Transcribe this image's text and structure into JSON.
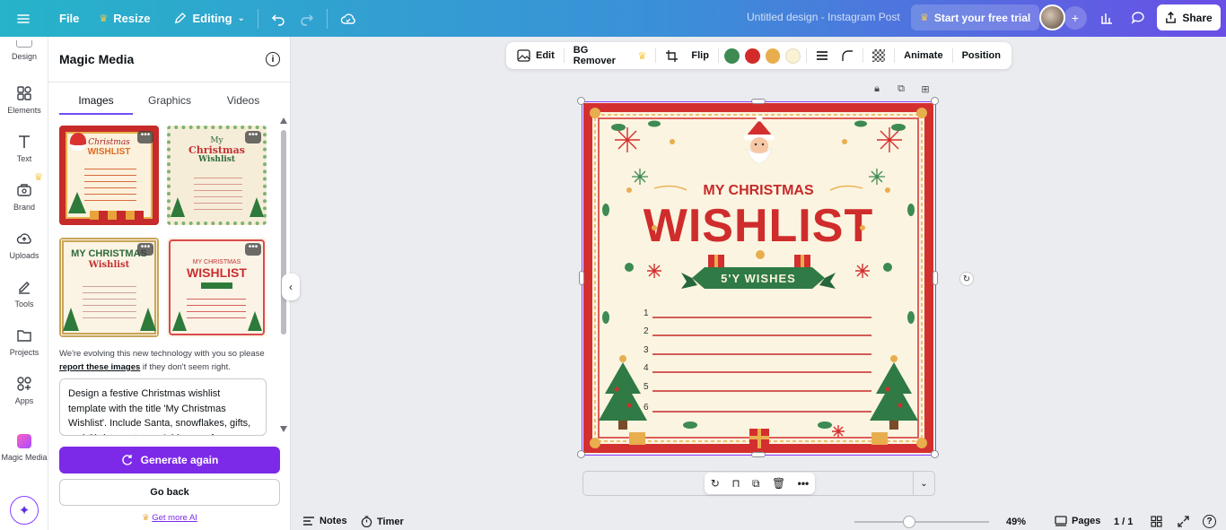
{
  "topbar": {
    "file": "File",
    "resize": "Resize",
    "editing": "Editing",
    "design_title": "Untitled design - Instagram Post",
    "trial": "Start your free trial",
    "share": "Share"
  },
  "rail": {
    "design": "Design",
    "elements": "Elements",
    "text": "Text",
    "brand": "Brand",
    "uploads": "Uploads",
    "tools": "Tools",
    "projects": "Projects",
    "apps": "Apps",
    "magic_media": "Magic Media"
  },
  "panel": {
    "title": "Magic Media",
    "tabs": [
      "Images",
      "Graphics",
      "Videos"
    ],
    "note_before": "We're evolving this new technology with you so please ",
    "note_link": "report these images",
    "note_after": " if they don't seem right.",
    "prompt": "Design a festive Christmas wishlist template with the title 'My Christmas Wishlist'. Include Santa, snowflakes, gifts, and Christmas trees. Add space for",
    "generate": "Generate again",
    "go_back": "Go back",
    "get_more": "Get more AI",
    "thumbs": [
      {
        "line1": "Christmas",
        "line2": "WISHLIST"
      },
      {
        "line1": "My",
        "line2": "Christmas",
        "line3": "Wishlist"
      },
      {
        "line1": "MY CHRISTMAS",
        "line2": "Wishlist"
      },
      {
        "line1": "MY CHRISTMAS",
        "line2": "WISHLIST"
      }
    ]
  },
  "context_bar": {
    "edit": "Edit",
    "bg_remover": "BG Remover",
    "flip": "Flip",
    "animate": "Animate",
    "position": "Position",
    "swatches": [
      "#3d8a52",
      "#d32b2b",
      "#e8ae4d",
      "#fbf2d4"
    ]
  },
  "poster": {
    "header": "MY CHRISTMAS",
    "title": "WISHLIST",
    "ribbon": "5'Y WISHES",
    "lines": [
      "1",
      "2",
      "3",
      "4",
      "5",
      "6"
    ]
  },
  "bottom": {
    "notes": "Notes",
    "timer": "Timer",
    "zoom": "49%",
    "pages": "Pages",
    "page_count": "1 / 1"
  }
}
